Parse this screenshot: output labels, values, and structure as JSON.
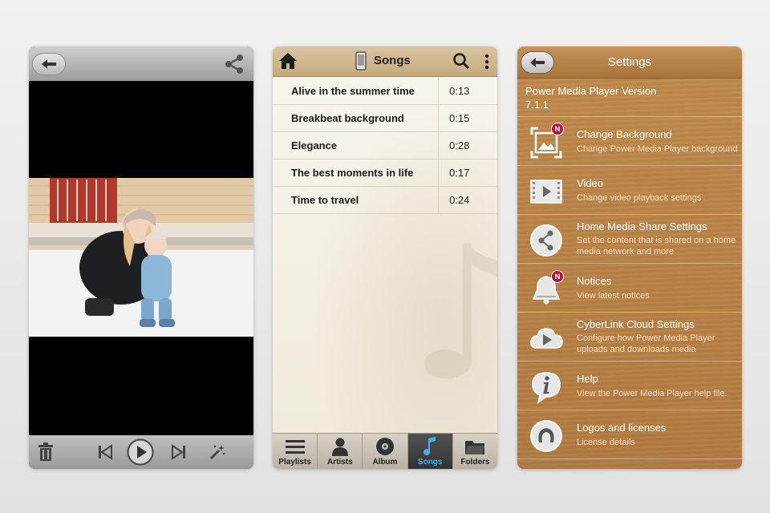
{
  "player": {
    "icons": [
      "back-arrow-icon",
      "share-icon",
      "trash-icon",
      "skip-previous-icon",
      "play-icon",
      "skip-next-icon",
      "magic-wand-icon"
    ]
  },
  "songs_screen": {
    "title": "Songs",
    "songs": [
      {
        "name": "Alive in the summer time",
        "duration": "0:13"
      },
      {
        "name": "Breakbeat background",
        "duration": "0:15"
      },
      {
        "name": "Elegance",
        "duration": "0:28"
      },
      {
        "name": "The best moments in life",
        "duration": "0:17"
      },
      {
        "name": "Time to travel",
        "duration": "0:24"
      }
    ],
    "tabs": [
      {
        "label": "Playlists",
        "icon": "list-icon"
      },
      {
        "label": "Artists",
        "icon": "person-icon"
      },
      {
        "label": "Album",
        "icon": "disc-icon"
      },
      {
        "label": "Songs",
        "icon": "music-note-icon",
        "active": true
      },
      {
        "label": "Folders",
        "icon": "folder-icon"
      }
    ],
    "active_color": "#3fb1ee"
  },
  "settings_screen": {
    "title": "Settings",
    "version_line1": "Power Media Player Version",
    "version_line2": "7.1.1",
    "items": [
      {
        "title": "Change Background",
        "subtitle": "Change Power Media Player background",
        "icon": "picture-icon",
        "badge": "N"
      },
      {
        "title": "Video",
        "subtitle": "Change video playback settings",
        "icon": "video-icon"
      },
      {
        "title": "Home Media Share Settings",
        "subtitle": "Set the content that is shared on a home media network and more",
        "icon": "share-network-icon"
      },
      {
        "title": "Notices",
        "subtitle": "View latest notices",
        "icon": "bell-icon",
        "badge": "N"
      },
      {
        "title": "CyberLink Cloud Settings",
        "subtitle": "Configure how Power Media Player uploads and downloads media",
        "icon": "cloud-icon"
      },
      {
        "title": "Help",
        "subtitle": "View the Power Media Player help file.",
        "icon": "info-icon"
      },
      {
        "title": "Logos and licenses",
        "subtitle": "License details",
        "icon": "license-icon"
      }
    ],
    "badge_color": "#b0164a"
  }
}
